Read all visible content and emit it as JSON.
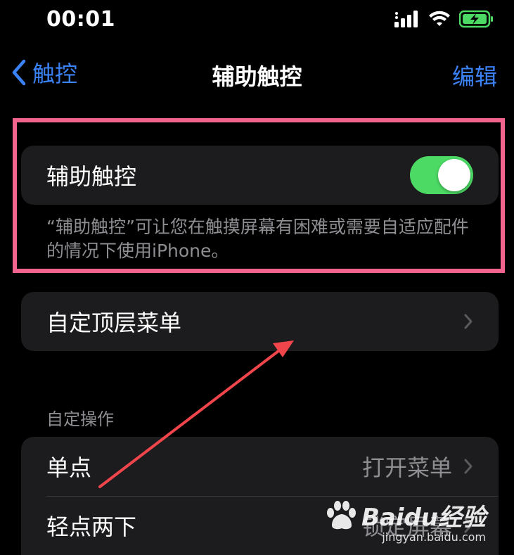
{
  "status_bar": {
    "time": "00:01"
  },
  "nav": {
    "back_label": "触控",
    "title": "辅助触控",
    "edit_label": "编辑"
  },
  "assistive_touch": {
    "label": "辅助触控",
    "enabled": true,
    "footer": "“辅助触控”可让您在触摸屏幕有困难或需要自适应配件的情况下使用iPhone。"
  },
  "top_menu": {
    "label": "自定顶层菜单"
  },
  "custom_actions": {
    "header": "自定操作",
    "rows": [
      {
        "label": "单点",
        "value": "打开菜单"
      },
      {
        "label": "轻点两下",
        "value": "锁定屏幕"
      }
    ]
  },
  "watermark": {
    "brand": "Baidu经验",
    "url": "jingyan.baidu.com"
  },
  "colors": {
    "accent": "#3b82f6",
    "toggle_on": "#4cd964",
    "highlight": "#f2648e",
    "annotation_arrow": "#f0454b"
  }
}
